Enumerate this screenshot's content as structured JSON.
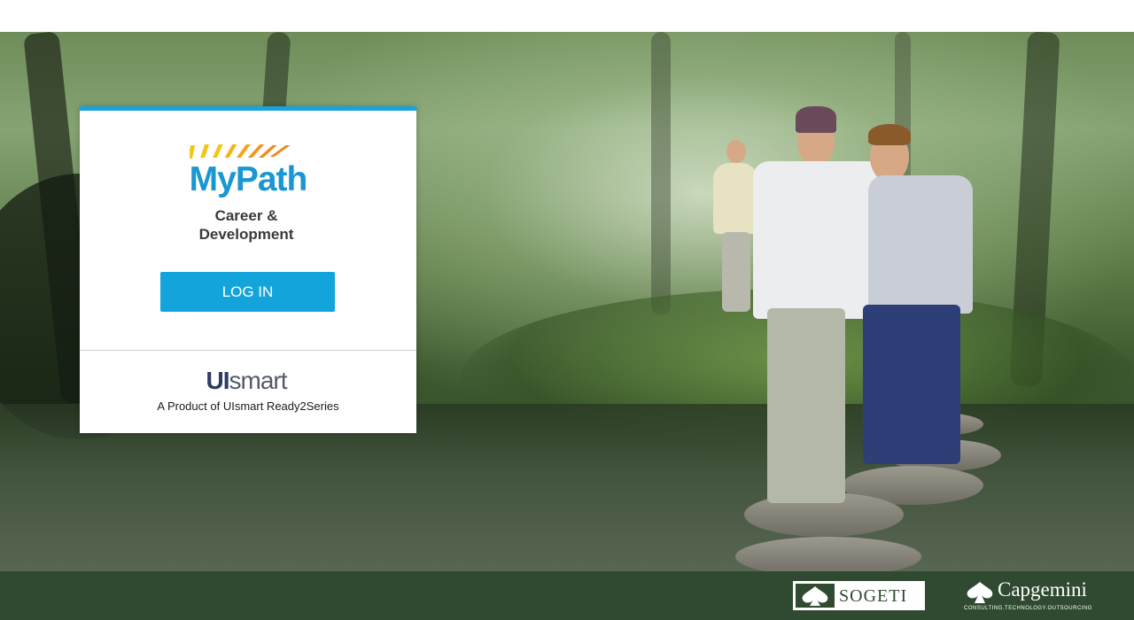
{
  "card": {
    "logo_text": "MyPath",
    "subtitle_line1": "Career &",
    "subtitle_line2": "Development",
    "login_label": "LOG IN",
    "vendor_logo_ui": "UI",
    "vendor_logo_smart": "smart",
    "product_text": "A Product of UIsmart Ready2Series"
  },
  "footer": {
    "partner1": "SOGETI",
    "partner2": "Capgemini",
    "partner2_tagline": "CONSULTING.TECHNOLOGY.OUTSOURCING"
  },
  "colors": {
    "accent": "#14a4dc",
    "logo_blue": "#1b96d3",
    "ray_yellow": "#f5c518",
    "ray_orange": "#f08a1c",
    "footer_green": "#2f4a30"
  },
  "icons": {
    "sogeti": "spade-mark-icon",
    "capgemini": "spade-mark-icon"
  }
}
